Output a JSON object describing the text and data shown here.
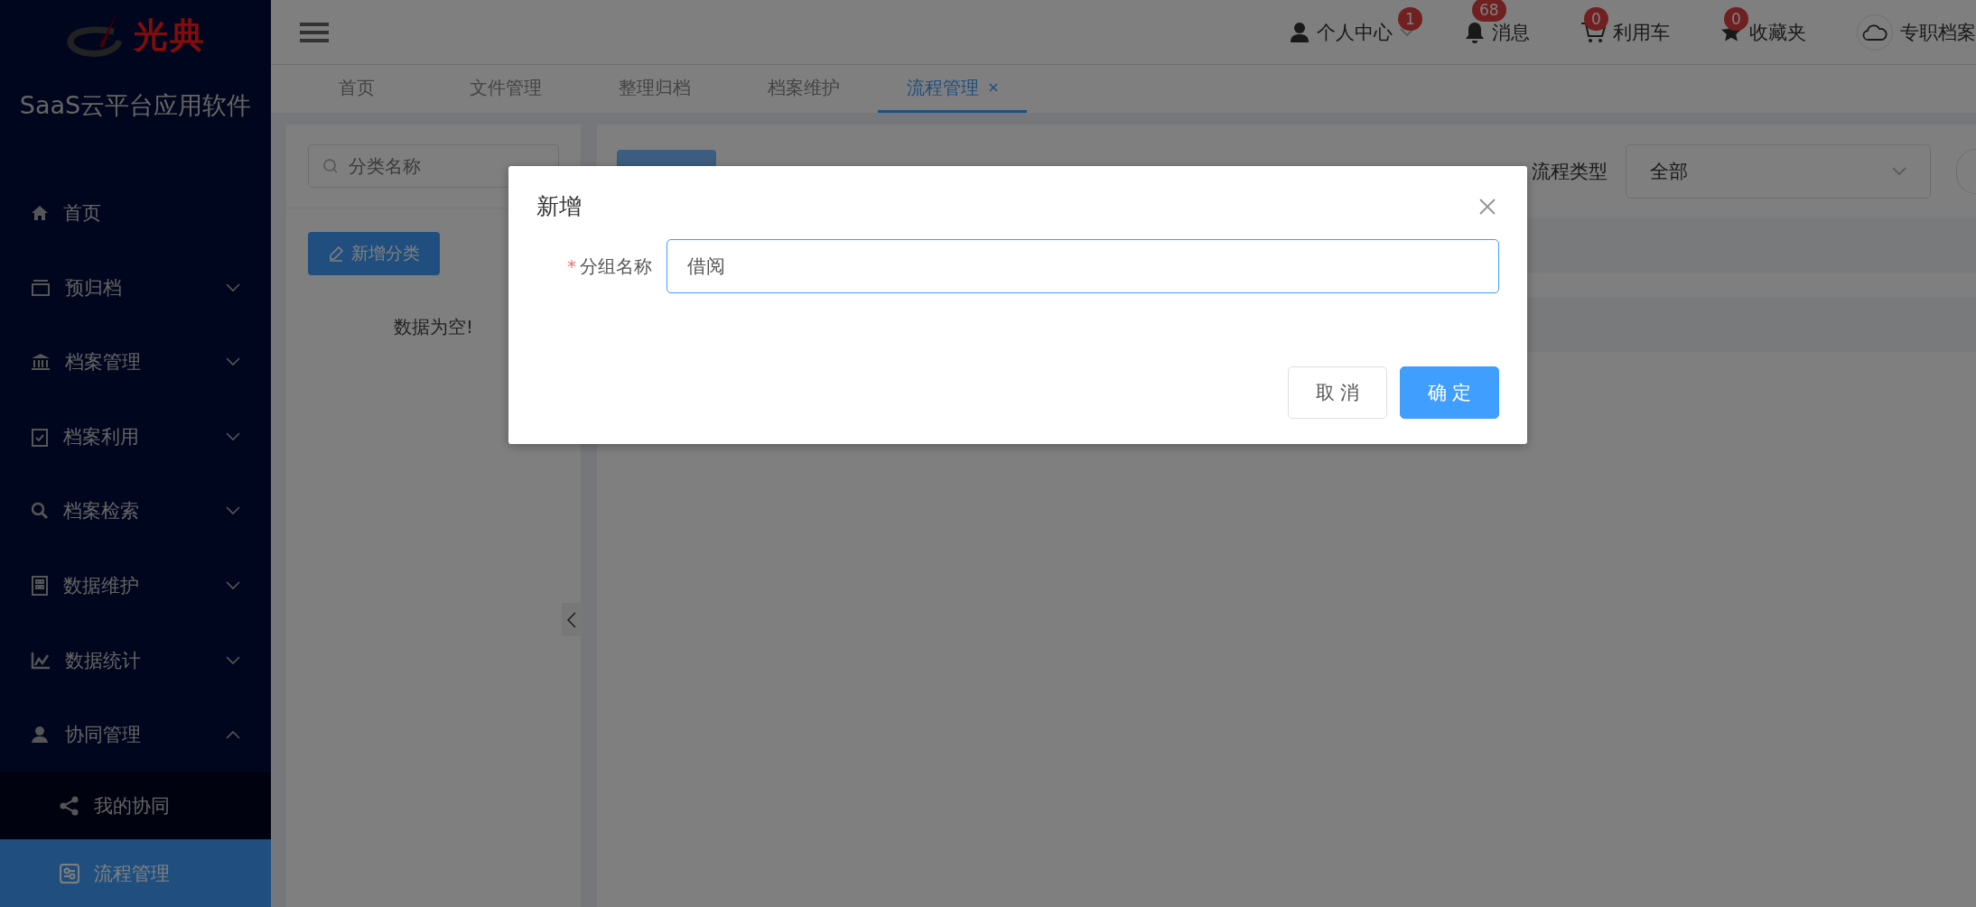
{
  "sidebar": {
    "logo_text": "光典",
    "title": "SaaS云平台应用软件",
    "items": [
      {
        "label": "首页",
        "kind": "link"
      },
      {
        "label": "预归档",
        "kind": "group",
        "expanded": false
      },
      {
        "label": "档案管理",
        "kind": "group",
        "expanded": false
      },
      {
        "label": "档案利用",
        "kind": "group",
        "expanded": false
      },
      {
        "label": "档案检索",
        "kind": "group",
        "expanded": false
      },
      {
        "label": "数据维护",
        "kind": "group",
        "expanded": false
      },
      {
        "label": "数据统计",
        "kind": "group",
        "expanded": false
      },
      {
        "label": "协同管理",
        "kind": "group",
        "expanded": true,
        "children": [
          {
            "label": "我的协同",
            "selected": false
          },
          {
            "label": "流程管理",
            "selected": true
          }
        ]
      }
    ]
  },
  "header": {
    "items": [
      {
        "label": "个人中心",
        "badge": "1",
        "kind": "user"
      },
      {
        "label": "消息",
        "badge": "68",
        "kind": "bell"
      },
      {
        "label": "利用车",
        "badge": "0",
        "kind": "cart"
      },
      {
        "label": "收藏夹",
        "badge": "0",
        "kind": "star"
      }
    ],
    "account": "专职档案"
  },
  "tabs": [
    {
      "label": "首页",
      "selected": false,
      "closable": false
    },
    {
      "label": "文件管理",
      "selected": false,
      "closable": false
    },
    {
      "label": "整理归档",
      "selected": false,
      "closable": false
    },
    {
      "label": "档案维护",
      "selected": false,
      "closable": false
    },
    {
      "label": "流程管理",
      "selected": true,
      "closable": true
    }
  ],
  "category_panel": {
    "search": {
      "placeholder": "分类名称"
    },
    "add_button": "新增分类",
    "empty_text": "数据为空!"
  },
  "process_panel": {
    "filter_label": "流程类型",
    "filter_value": "全部"
  },
  "dialog": {
    "title": "新增",
    "field": {
      "label": "分组名称",
      "required": true,
      "required_mark": "*",
      "value": "借阅"
    },
    "buttons": [
      {
        "label": "取 消",
        "kind": "secondary"
      },
      {
        "label": "确 定",
        "kind": "primary"
      }
    ]
  }
}
